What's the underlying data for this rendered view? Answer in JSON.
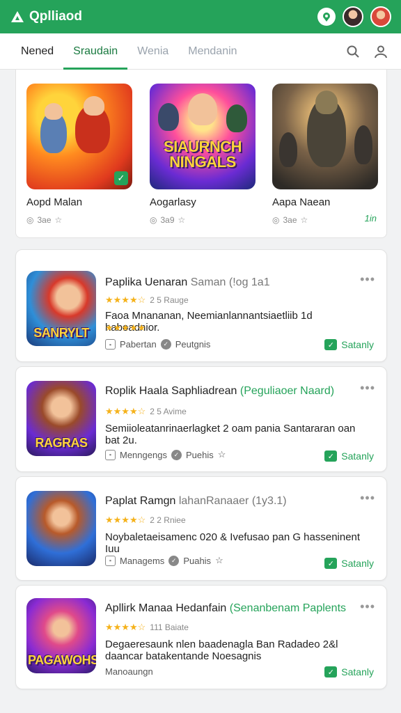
{
  "app": {
    "title": "Qplliaod",
    "accent": "#25a35a"
  },
  "tabs": [
    {
      "label": "Nened"
    },
    {
      "label": "Sraudain"
    },
    {
      "label": "Wenia"
    },
    {
      "label": "Mendanin"
    }
  ],
  "featured": [
    {
      "name": "Aopd Malan",
      "count": "3ae",
      "thumb_text": ""
    },
    {
      "name": "Aogarlasy",
      "count": "3a9",
      "thumb_text": "SIAURNCH NINGALS"
    },
    {
      "name": "Aapa Naean",
      "count": "3ae",
      "thumb_text": ""
    }
  ],
  "featured_link": "1in",
  "list": [
    {
      "title": "Paplika Uenaran",
      "subtitle": "Saman (!og 1a1",
      "rating_text": "2 5 Rauge",
      "description": "Faoa Mnananan, Neemianlannantsiaetliib 1d haboadnior.",
      "icon_text": "SANRYLT",
      "meta_left": "Pabertan",
      "meta_right": "Peutgnis",
      "safe": "Satanly"
    },
    {
      "title": "Roplik Haala Saphliadrean",
      "subtitle": "(Peguliaoer Naard)",
      "rating_text": "2 5 Avime",
      "description": "Semiioleatanrinaerlagket 2 oam pania Santararan oan bat 2u.",
      "icon_text": "RAGRAS",
      "meta_left": "Menngengs",
      "meta_right": "Puehis",
      "safe": "Satanly"
    },
    {
      "title": "Paplat Ramgn",
      "subtitle": "lahanRanaaer (1y3.1)",
      "rating_text": "2 2 Rniee",
      "description": "Noybaletaeisamenc 020 & Ivefusao pan G hasseninent Iuu",
      "icon_text": "",
      "meta_left": "Managems",
      "meta_right": "Puahis",
      "safe": "Satanly"
    },
    {
      "title": "Apllirk Manaa Hedanfain",
      "subtitle": "(Senanbenam Paplents",
      "rating_text": "111 Baiate",
      "description": "Degaeresaunk nlen baadenagla Ban Radadeo 2&l daancar batakentande Noesagnis",
      "icon_text": "PAGAWOHS",
      "meta_left": "Manoaungn",
      "meta_right": "",
      "safe": "Satanly"
    }
  ]
}
